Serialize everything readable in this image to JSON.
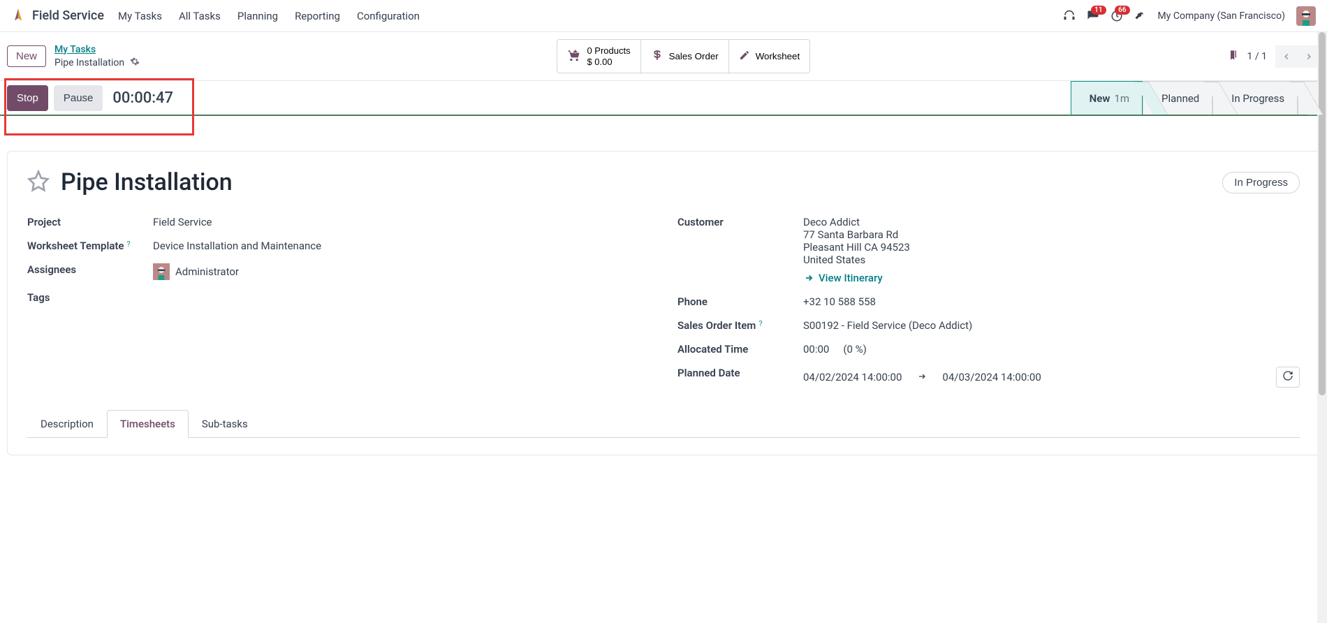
{
  "app": {
    "title": "Field Service"
  },
  "nav": {
    "items": [
      "My Tasks",
      "All Tasks",
      "Planning",
      "Reporting",
      "Configuration"
    ],
    "messages_badge": "11",
    "activities_badge": "66",
    "company": "My Company (San Francisco)"
  },
  "controlbar": {
    "new_label": "New",
    "breadcrumb_top": "My Tasks",
    "breadcrumb_bottom": "Pipe Installation",
    "products_count": "0 Products",
    "products_amount": "$ 0.00",
    "sales_order_label": "Sales Order",
    "worksheet_label": "Worksheet",
    "page_info": "1 / 1"
  },
  "statusbar": {
    "stop": "Stop",
    "pause": "Pause",
    "timer": "00:00:47",
    "stages": {
      "new": "New",
      "new_duration": "1m",
      "planned": "Planned",
      "in_progress": "In Progress",
      "more": "..."
    }
  },
  "form": {
    "title": "Pipe Installation",
    "status_pill": "In Progress",
    "labels": {
      "project": "Project",
      "worksheet_template": "Worksheet Template",
      "assignees": "Assignees",
      "tags": "Tags",
      "customer": "Customer",
      "phone": "Phone",
      "sales_order_item": "Sales Order Item",
      "allocated_time": "Allocated Time",
      "planned_date": "Planned Date"
    },
    "values": {
      "project": "Field Service",
      "worksheet_template": "Device Installation and Maintenance",
      "assignee_name": "Administrator",
      "customer_name": "Deco Addict",
      "customer_addr1": "77 Santa Barbara Rd",
      "customer_addr2": "Pleasant Hill CA 94523",
      "customer_country": "United States",
      "view_itinerary": "View Itinerary",
      "phone": "+32 10 588 558",
      "sales_order_item": "S00192 - Field Service (Deco Addict)",
      "allocated_time": "00:00",
      "allocated_pct": "(0 %)",
      "planned_start": "04/02/2024 14:00:00",
      "planned_end": "04/03/2024 14:00:00"
    }
  },
  "tabs": {
    "description": "Description",
    "timesheets": "Timesheets",
    "subtasks": "Sub-tasks"
  }
}
